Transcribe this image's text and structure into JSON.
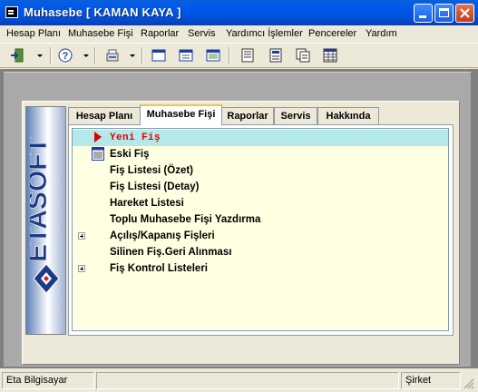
{
  "window": {
    "title": "Muhasebe [ KAMAN KAYA ]",
    "controls": {
      "minimize": "minimize",
      "maximize": "maximize",
      "close": "close"
    }
  },
  "menu": [
    {
      "label": "Hesap Planı"
    },
    {
      "label": "Muhasebe Fişi"
    },
    {
      "label": "Raporlar"
    },
    {
      "label": "Servis"
    },
    {
      "label": "Yardımcı İşlemler"
    },
    {
      "label": "Pencereler"
    },
    {
      "label": "Yardım"
    }
  ],
  "toolbar": {
    "icons": [
      "exit-icon",
      "help-icon",
      "tools-icon",
      "window-icon-1",
      "window-icon-2",
      "window-icon-3",
      "report-icon-1",
      "report-icon-2",
      "report-icon-3",
      "grid-icon"
    ]
  },
  "brand": {
    "logo_text": "ETASOFT"
  },
  "tabs": [
    {
      "label": "Hesap Planı",
      "active": false
    },
    {
      "label": "Muhasebe Fişi",
      "active": true
    },
    {
      "label": "Raporlar",
      "active": false
    },
    {
      "label": "Servis",
      "active": false
    },
    {
      "label": "Hakkında",
      "active": false
    }
  ],
  "tree": [
    {
      "label": "Yeni Fiş",
      "selected": true,
      "expandable": false,
      "icon": "arrow-right-icon"
    },
    {
      "label": "Eski Fiş",
      "selected": false,
      "expandable": false,
      "icon": "list-icon"
    },
    {
      "label": "Fiş Listesi (Özet)",
      "selected": false,
      "expandable": false
    },
    {
      "label": "Fiş Listesi (Detay)",
      "selected": false,
      "expandable": false
    },
    {
      "label": "Hareket Listesi",
      "selected": false,
      "expandable": false
    },
    {
      "label": "Toplu Muhasebe Fişi Yazdırma",
      "selected": false,
      "expandable": false
    },
    {
      "label": "Açılış/Kapanış Fişleri",
      "selected": false,
      "expandable": true
    },
    {
      "label": "Silinen Fiş.Geri Alınması",
      "selected": false,
      "expandable": false
    },
    {
      "label": "Fiş Kontrol Listeleri",
      "selected": false,
      "expandable": true
    }
  ],
  "status": {
    "company": "Eta Bilgisayar",
    "middle": "",
    "mode": "Şirket"
  },
  "colors": {
    "titlebar": "#0058ee",
    "tree_background": "#ffffe1",
    "selection": "#b5e8e8",
    "new_item": "#e00000",
    "active_tab_accent": "#f7c545"
  }
}
